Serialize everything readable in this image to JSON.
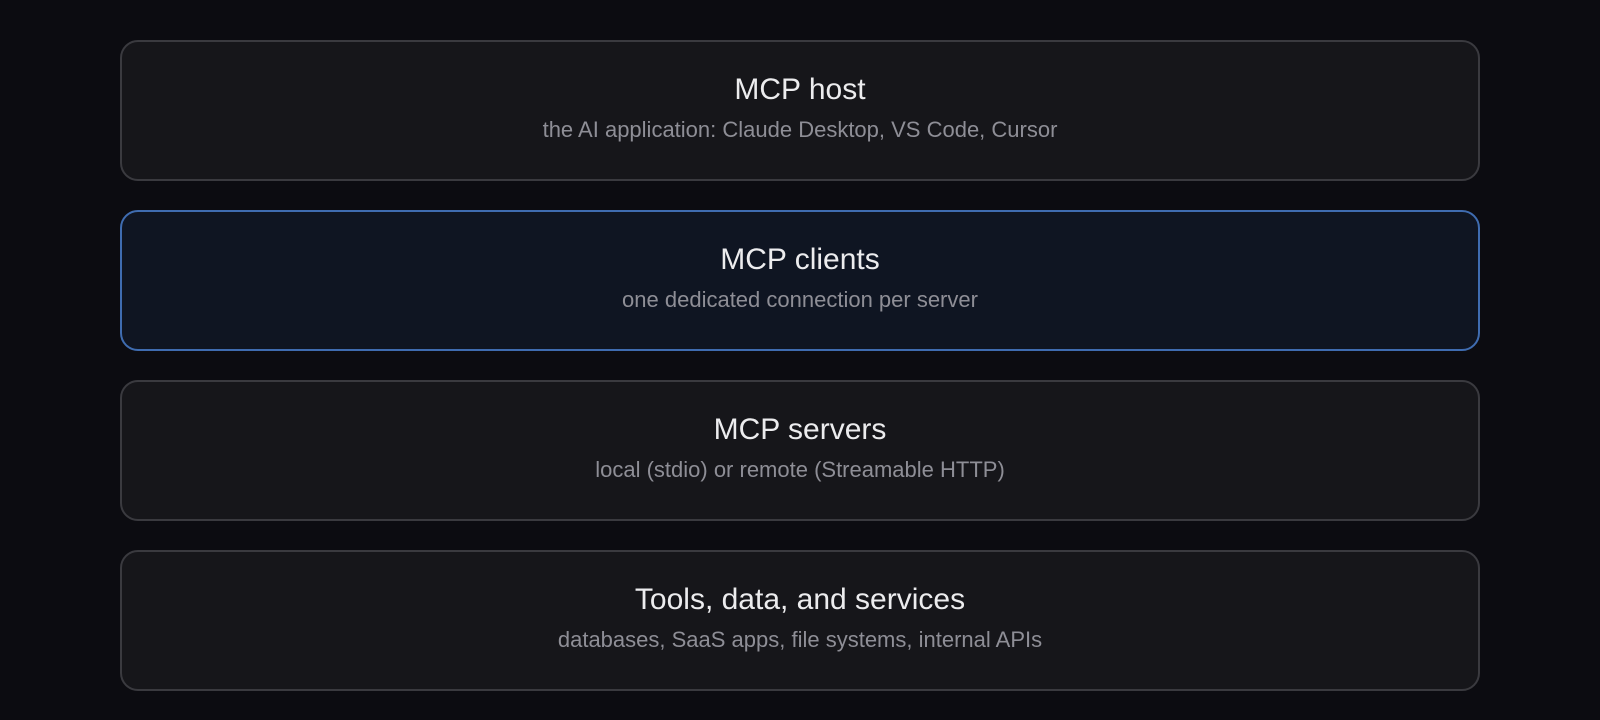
{
  "layers": [
    {
      "title": "MCP host",
      "subtitle": "the AI application: Claude Desktop, VS Code, Cursor",
      "highlighted": false
    },
    {
      "title": "MCP clients",
      "subtitle": "one dedicated connection per server",
      "highlighted": true
    },
    {
      "title": "MCP servers",
      "subtitle": "local (stdio) or remote (Streamable HTTP)",
      "highlighted": false
    },
    {
      "title": "Tools, data, and services",
      "subtitle": "databases, SaaS apps, file systems, internal APIs",
      "highlighted": false
    }
  ],
  "colors": {
    "background": "#0c0c11",
    "box_fill": "#16161a",
    "box_border": "#3a3a3f",
    "highlight_fill": "#0f1522",
    "highlight_border": "#3f6cb0",
    "title_text": "#ececee",
    "subtitle_text": "#8e8e96"
  }
}
